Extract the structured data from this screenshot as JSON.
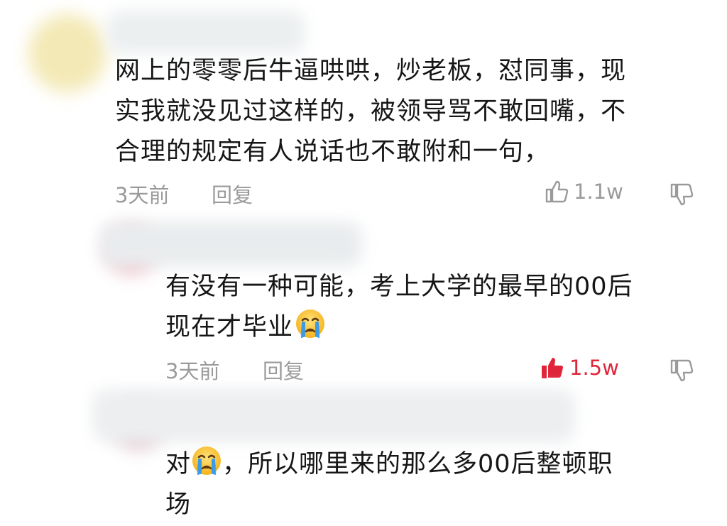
{
  "comments": [
    {
      "lines": [
        "网上的零零后牛逼哄哄，炒老板，怼同事，现",
        "实我就没见过这样的，被领导骂不敢回嘴，不",
        "合理的规定有人说话也不敢附和一句，"
      ],
      "time": "3天前",
      "reply_label": "回复",
      "likes": "1.1w",
      "liked": false
    },
    {
      "lines": [
        "有没有一种可能，考上大学的最早的00后",
        "现在才毕业"
      ],
      "emoji": "crying-face-icon",
      "time": "3天前",
      "reply_label": "回复",
      "likes": "1.5w",
      "liked": true
    },
    {
      "lines_before_emoji": "对",
      "line1_after_emoji": "，所以哪里来的那么多00后整顿职",
      "line2": "场",
      "emoji": "crying-face-icon"
    }
  ],
  "colors": {
    "text": "#161616",
    "meta": "#9a9a9a",
    "like_active": "#e0243a"
  }
}
